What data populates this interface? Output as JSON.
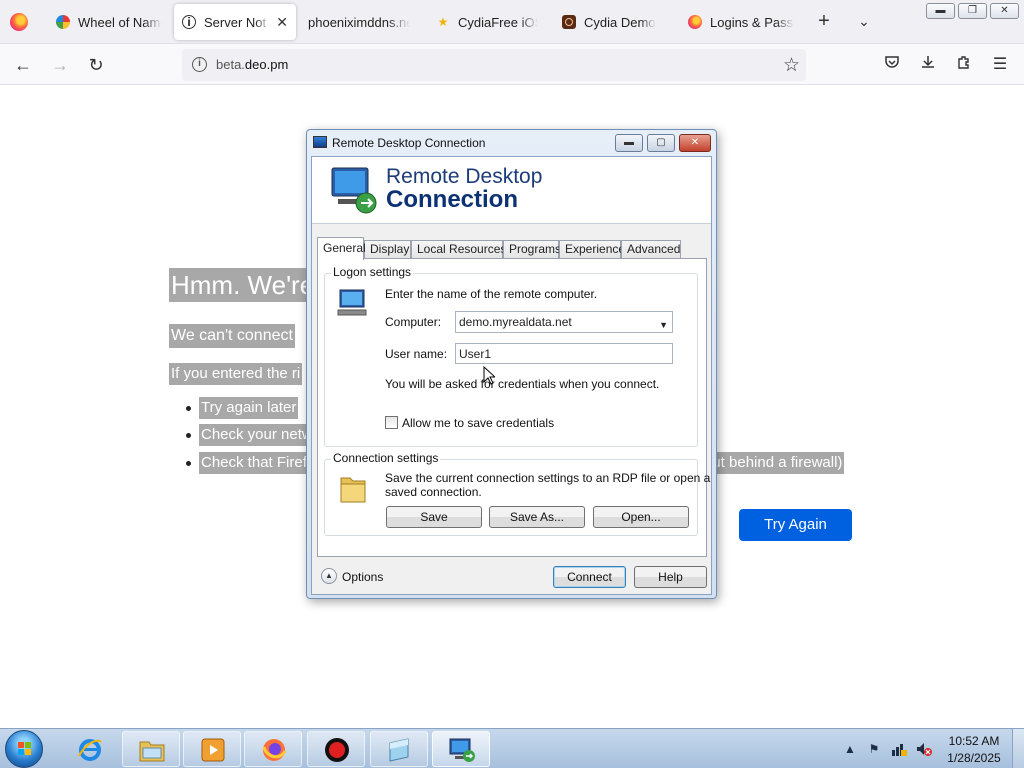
{
  "browser": {
    "tabs": [
      {
        "label": "Wheel of Names",
        "icon": "wheel-icon"
      },
      {
        "label": "Server Not Found",
        "icon": "info-icon",
        "active": true
      },
      {
        "label": "phoeniximddns.net",
        "icon": "none"
      },
      {
        "label": "CydiaFree iOS App",
        "icon": "star-icon"
      },
      {
        "label": "Cydia Demo",
        "icon": "cydia-icon"
      },
      {
        "label": "Logins & Passwords",
        "icon": "firefox-icon"
      }
    ],
    "url_host_prefix": "beta.",
    "url_host_domain": "deo.pm"
  },
  "error_page": {
    "title": "Hmm. We're",
    "line1": "We can't connect",
    "line2": "If you entered the ri",
    "bullets": [
      "Try again later",
      "Check your netw",
      "Check that Firefo"
    ],
    "bullet3_tail": "out behind a firewall)",
    "try_again_label": "Try Again"
  },
  "rdp": {
    "window_title": "Remote Desktop Connection",
    "banner_line1": "Remote Desktop",
    "banner_line2": "Connection",
    "tabs": [
      "General",
      "Display",
      "Local Resources",
      "Programs",
      "Experience",
      "Advanced"
    ],
    "logon_group": "Logon settings",
    "logon_hint": "Enter the name of the remote computer.",
    "computer_label": "Computer:",
    "computer_value": "demo.myrealdata.net",
    "username_label": "User name:",
    "username_value": "User1",
    "credentials_note": "You will be asked for credentials when you connect.",
    "save_credentials_label": "Allow me to save credentials",
    "save_credentials_checked": false,
    "connection_group": "Connection settings",
    "connection_text_1": "Save the current connection settings to an RDP file or open a",
    "connection_text_2": "saved connection.",
    "save_label": "Save",
    "save_as_label": "Save As...",
    "open_label": "Open...",
    "options_label": "Options",
    "connect_label": "Connect",
    "help_label": "Help"
  },
  "taskbar": {
    "clock_time": "10:52 AM",
    "clock_date": "1/28/2025"
  },
  "colors": {
    "try_again_bg": "#0061e0",
    "rdp_banner_text": "#0d3273",
    "selection_bg": "#a8a8a8",
    "taskbar_bg": "#b5cce6"
  }
}
